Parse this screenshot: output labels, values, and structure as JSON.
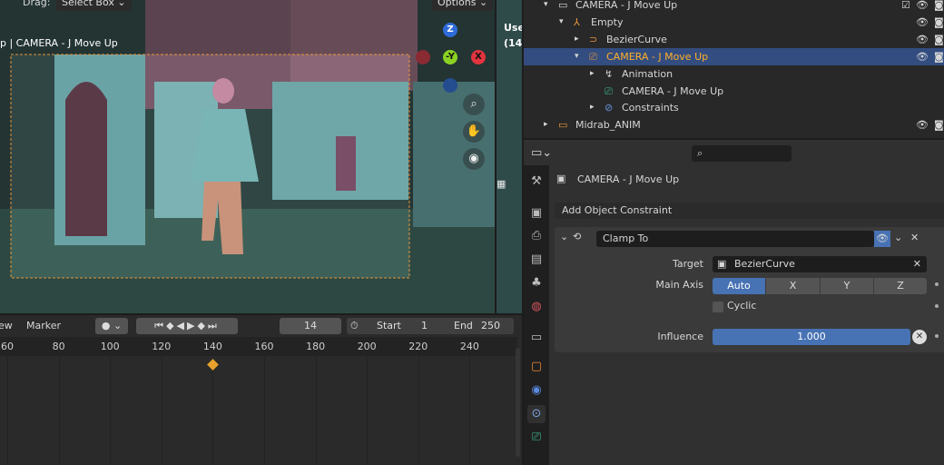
{
  "viewport": {
    "drag_label": "Drag:",
    "select_mode": "Select Box",
    "options_label": "Options",
    "camera_title": "p | CAMERA - J Move Up",
    "side_view_text": "Use",
    "side_view_frame": "(14",
    "gizmo": {
      "z": "Z",
      "y": "-Y",
      "x": "X"
    }
  },
  "timeline": {
    "menu": [
      "ew",
      "Marker"
    ],
    "current_frame": "14",
    "start_label": "Start",
    "start": "1",
    "end_label": "End",
    "end": "250",
    "ticks": [
      "60",
      "80",
      "100",
      "120",
      "140",
      "160",
      "180",
      "200",
      "220",
      "240"
    ],
    "keyframe": 140
  },
  "outliner": {
    "rows": [
      {
        "label": "CAMERA - J Move Up",
        "icon": "collection-icon"
      },
      {
        "label": "Empty",
        "icon": "empty-icon"
      },
      {
        "label": "BezierCurve",
        "icon": "curve-icon"
      },
      {
        "label": "CAMERA - J Move Up",
        "icon": "camera-object-icon",
        "selected": true
      },
      {
        "label": "Animation",
        "icon": "animation-icon"
      },
      {
        "label": "CAMERA - J Move Up",
        "icon": "camera-data-icon"
      },
      {
        "label": "Constraints",
        "icon": "constraint-icon"
      },
      {
        "label": "Midrab_ANIM",
        "icon": "collection-icon"
      }
    ]
  },
  "properties": {
    "object_name": "CAMERA - J Move Up",
    "add_constraint": "Add Object Constraint",
    "constraint_name": "Clamp To",
    "target_label": "Target",
    "target": "BezierCurve",
    "main_axis_label": "Main Axis",
    "axes": [
      "Auto",
      "X",
      "Y",
      "Z"
    ],
    "active_axis": "Auto",
    "cyclic_label": "Cyclic",
    "cyclic": false,
    "influence_label": "Influence",
    "influence": "1.000",
    "influence_fraction": 1.0
  },
  "colors": {
    "accent": "#4772b3",
    "selected_row": "#334d80",
    "selected_text": "#ffaf29",
    "keyframe": "#e8a22b"
  }
}
